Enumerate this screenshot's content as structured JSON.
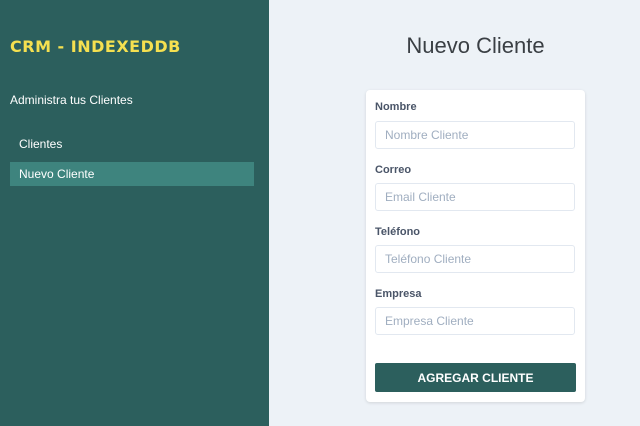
{
  "sidebar": {
    "brand": "CRM - INDEXEDDB",
    "subtitle": "Administra tus Clientes",
    "nav": [
      {
        "label": "Clientes",
        "active": false
      },
      {
        "label": "Nuevo Cliente",
        "active": true
      }
    ]
  },
  "main": {
    "title": "Nuevo Cliente",
    "form": {
      "fields": [
        {
          "label": "Nombre",
          "placeholder": "Nombre Cliente",
          "value": ""
        },
        {
          "label": "Correo",
          "placeholder": "Email Cliente",
          "value": ""
        },
        {
          "label": "Teléfono",
          "placeholder": "Teléfono Cliente",
          "value": ""
        },
        {
          "label": "Empresa",
          "placeholder": "Empresa Cliente",
          "value": ""
        }
      ],
      "submit_label": "AGREGAR CLIENTE"
    }
  },
  "colors": {
    "sidebar_bg": "#2c5f5d",
    "brand_yellow": "#f5e050",
    "active_nav_bg": "#3e847e",
    "page_bg": "#edf2f7"
  }
}
